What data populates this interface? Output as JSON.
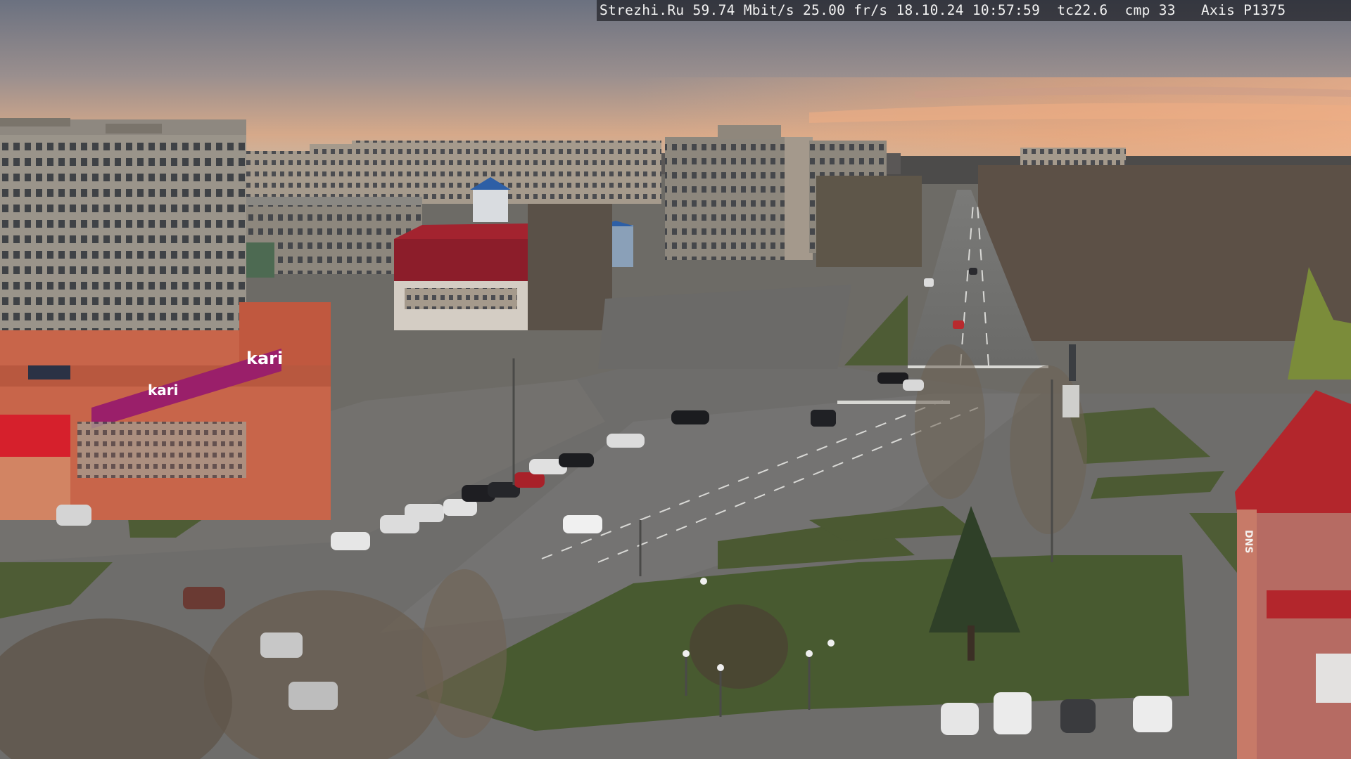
{
  "camera_overlay": {
    "site": "Strezhi.Ru",
    "bitrate": "59.74 Mbit/s",
    "framerate": "25.00 fr/s",
    "date": "18.10.24",
    "time": "10:57:59",
    "tc": "tc22.6",
    "cmp": "cmp 33",
    "camera_model": "Axis P1375"
  },
  "store_signs": {
    "kari_banner": "kari",
    "kari_side": "kari",
    "tall_building_sign": "DNS"
  },
  "palette": {
    "sky_top": "#6e7382",
    "sky_horizon": "#e8b48a",
    "asphalt": "#6f6e6c",
    "grass": "#4a5a34",
    "kari_magenta": "#9a1f6a",
    "red_roof": "#b3262c"
  }
}
